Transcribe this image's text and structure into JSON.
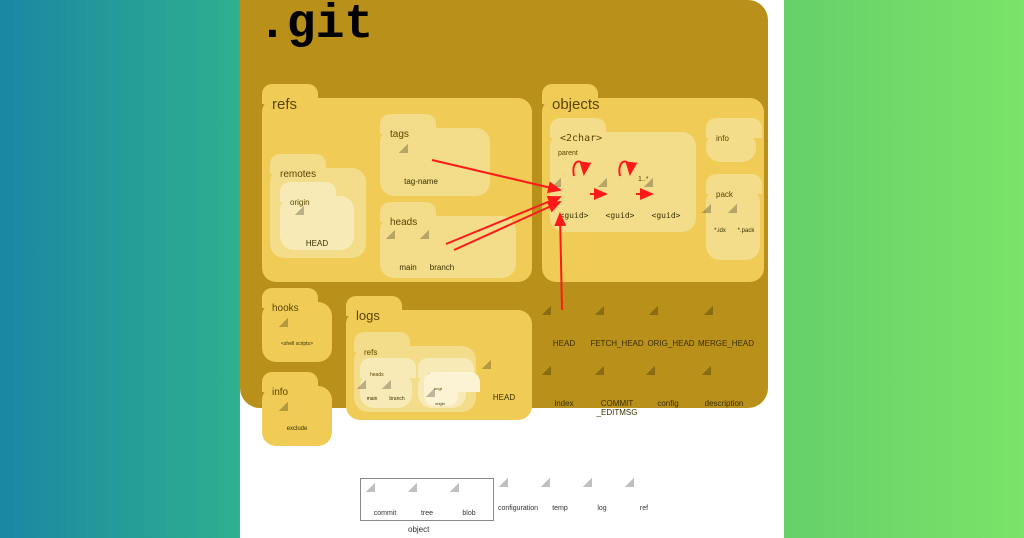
{
  "title": ".git",
  "folders": {
    "refs": "refs",
    "objects": "objects",
    "hooks": "hooks",
    "info_root": "info",
    "logs": "logs",
    "remotes": "remotes",
    "tags": "tags",
    "heads": "heads",
    "logs_refs": "refs",
    "two_char": "<2char>",
    "obj_info": "info",
    "pack": "pack",
    "origin": "origin",
    "logs_heads": "heads",
    "logs_remotes": "remotes",
    "logs_origin": "origin"
  },
  "files": {
    "remotes_head": "HEAD",
    "tag_name": "tag-name",
    "heads_main": "main",
    "heads_branch": "branch",
    "guid1": "<guid>",
    "guid2": "<guid>",
    "guid3": "<guid>",
    "pack_idx": "*.idx",
    "pack_pack": "*.pack",
    "shell_scripts": "<shell scripts>",
    "exclude": "exclude",
    "logs_main": "main",
    "logs_branch": "branch",
    "logs_origin_file": "origin",
    "logs_head": "HEAD",
    "root_head": "HEAD",
    "fetch_head": "FETCH_HEAD",
    "orig_head": "ORIG_HEAD",
    "merge_head": "MERGE_HEAD",
    "index": "index",
    "commit_editmsg": "COMMIT _EDITMSG",
    "config": "config",
    "description": "description"
  },
  "annot": {
    "parent": "parent",
    "one_star": "1..*"
  },
  "legend": {
    "commit": "commit",
    "tree": "tree",
    "blob": "blob",
    "configuration": "configuration",
    "temp": "temp",
    "log": "log",
    "ref": "ref",
    "object": "object"
  }
}
